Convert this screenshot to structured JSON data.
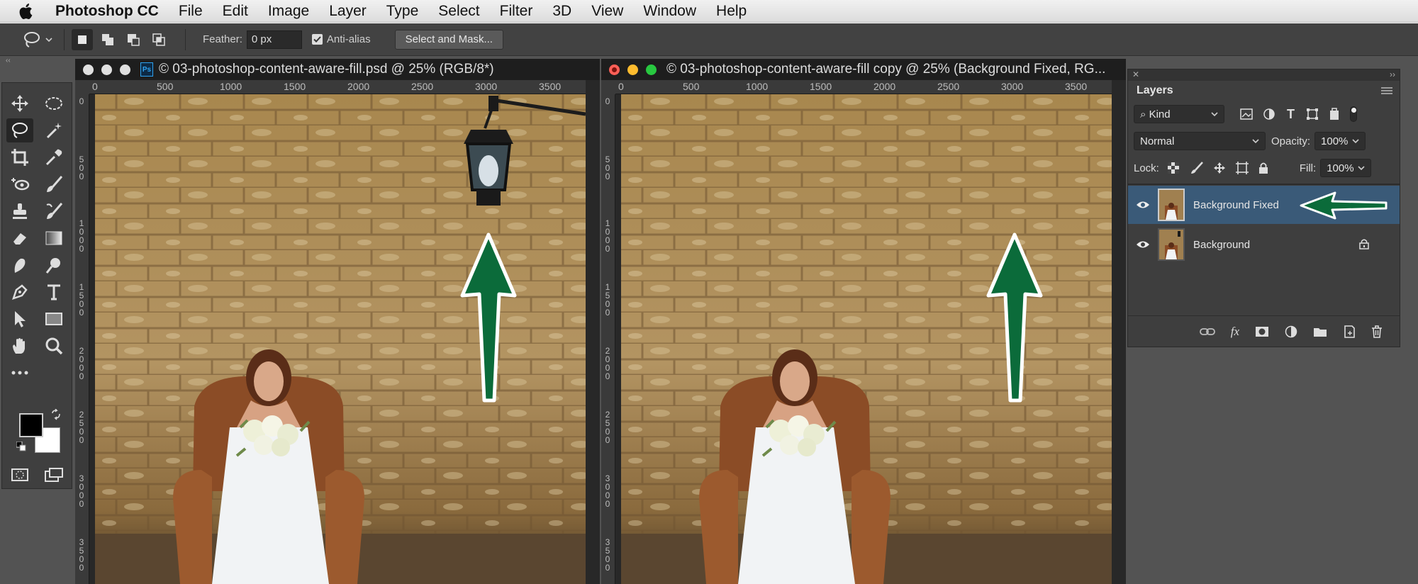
{
  "menubar": {
    "app_name": "Photoshop CC",
    "items": [
      "File",
      "Edit",
      "Image",
      "Layer",
      "Type",
      "Select",
      "Filter",
      "3D",
      "View",
      "Window",
      "Help"
    ]
  },
  "options_bar": {
    "feather_label": "Feather:",
    "feather_value": "0 px",
    "antialias_label": "Anti-alias",
    "antialias_checked": true,
    "select_mask_label": "Select and Mask..."
  },
  "documents": [
    {
      "title": "© 03-photoshop-content-aware-fill.psd @ 25% (RGB/8*)",
      "ruler_h": [
        "0",
        "500",
        "1000",
        "1500",
        "2000",
        "2500",
        "3000",
        "3500"
      ],
      "ruler_v": [
        "0",
        "500",
        "1000",
        "1500",
        "2000",
        "2500",
        "3000",
        "3500"
      ]
    },
    {
      "title": "© 03-photoshop-content-aware-fill copy @ 25% (Background Fixed, RG...",
      "ruler_h": [
        "0",
        "500",
        "1000",
        "1500",
        "2000",
        "2500",
        "3000",
        "3500"
      ],
      "ruler_v": [
        "0",
        "500",
        "1000",
        "1500",
        "2000",
        "2500",
        "3000",
        "3500"
      ]
    }
  ],
  "layers_panel": {
    "tab_label": "Layers",
    "filter_kind": "Kind",
    "blend_mode": "Normal",
    "opacity_label": "Opacity:",
    "opacity_value": "100%",
    "lock_label": "Lock:",
    "fill_label": "Fill:",
    "fill_value": "100%",
    "layers": [
      {
        "name": "Background Fixed",
        "selected": true,
        "locked": false
      },
      {
        "name": "Background",
        "selected": false,
        "locked": true
      }
    ]
  },
  "colors": {
    "accent_arrow": "#0b6b3a",
    "selection": "#3a5a78",
    "chrome_dark": "#282828",
    "panel": "#3e3e3e"
  }
}
